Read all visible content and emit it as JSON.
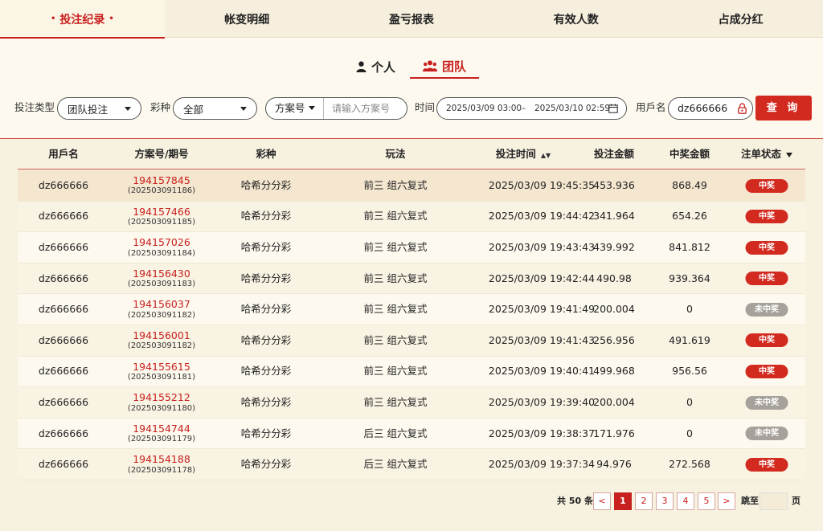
{
  "top_tabs": [
    {
      "label": "投注纪录",
      "active": true
    },
    {
      "label": "帐变明细",
      "active": false
    },
    {
      "label": "盈亏报表",
      "active": false
    },
    {
      "label": "有效人数",
      "active": false
    },
    {
      "label": "占成分红",
      "active": false
    }
  ],
  "active_marker": "•",
  "mode": {
    "personal": "个人",
    "team": "团队",
    "active": "team"
  },
  "filter": {
    "bet_type_label": "投注类型",
    "bet_type_value": "团队投注",
    "lottery_label": "彩种",
    "lottery_value": "全部",
    "plan_type_value": "方案号",
    "plan_placeholder": "请输入方案号",
    "time_label": "时间",
    "time_start": "2025/03/09 03:00",
    "time_sep": "–",
    "time_end": "2025/03/10 02:59",
    "username_label": "用戶名",
    "username_value": "dz666666",
    "query_label": "查 询"
  },
  "table": {
    "headers": [
      "用戶名",
      "方案号/期号",
      "彩种",
      "玩法",
      "投注时间",
      "投注金额",
      "中奖金额",
      "注单状态"
    ],
    "rows": [
      {
        "user": "dz666666",
        "plan": "194157845",
        "issue": "(202503091186)",
        "lottery": "哈希分分彩",
        "play": "前三 组六复式",
        "time": "2025/03/09 19:45:35",
        "amount": "453.936",
        "win": "868.49",
        "status": "中奖"
      },
      {
        "user": "dz666666",
        "plan": "194157466",
        "issue": "(202503091185)",
        "lottery": "哈希分分彩",
        "play": "前三 组六复式",
        "time": "2025/03/09 19:44:42",
        "amount": "341.964",
        "win": "654.26",
        "status": "中奖"
      },
      {
        "user": "dz666666",
        "plan": "194157026",
        "issue": "(202503091184)",
        "lottery": "哈希分分彩",
        "play": "前三 组六复式",
        "time": "2025/03/09 19:43:43",
        "amount": "439.992",
        "win": "841.812",
        "status": "中奖"
      },
      {
        "user": "dz666666",
        "plan": "194156430",
        "issue": "(202503091183)",
        "lottery": "哈希分分彩",
        "play": "前三 组六复式",
        "time": "2025/03/09 19:42:44",
        "amount": "490.98",
        "win": "939.364",
        "status": "中奖"
      },
      {
        "user": "dz666666",
        "plan": "194156037",
        "issue": "(202503091182)",
        "lottery": "哈希分分彩",
        "play": "前三 组六复式",
        "time": "2025/03/09 19:41:49",
        "amount": "200.004",
        "win": "0",
        "status": "未中奖"
      },
      {
        "user": "dz666666",
        "plan": "194156001",
        "issue": "(202503091182)",
        "lottery": "哈希分分彩",
        "play": "前三 组六复式",
        "time": "2025/03/09 19:41:43",
        "amount": "256.956",
        "win": "491.619",
        "status": "中奖"
      },
      {
        "user": "dz666666",
        "plan": "194155615",
        "issue": "(202503091181)",
        "lottery": "哈希分分彩",
        "play": "前三 组六复式",
        "time": "2025/03/09 19:40:41",
        "amount": "499.968",
        "win": "956.56",
        "status": "中奖"
      },
      {
        "user": "dz666666",
        "plan": "194155212",
        "issue": "(202503091180)",
        "lottery": "哈希分分彩",
        "play": "前三 组六复式",
        "time": "2025/03/09 19:39:40",
        "amount": "200.004",
        "win": "0",
        "status": "未中奖"
      },
      {
        "user": "dz666666",
        "plan": "194154744",
        "issue": "(202503091179)",
        "lottery": "哈希分分彩",
        "play": "后三 组六复式",
        "time": "2025/03/09 19:38:37",
        "amount": "171.976",
        "win": "0",
        "status": "未中奖"
      },
      {
        "user": "dz666666",
        "plan": "194154188",
        "issue": "(202503091178)",
        "lottery": "哈希分分彩",
        "play": "后三 组六复式",
        "time": "2025/03/09 19:37:34",
        "amount": "94.976",
        "win": "272.568",
        "status": "中奖"
      }
    ]
  },
  "pagination": {
    "total_text": "共 50 条",
    "prev": "<",
    "pages": [
      "1",
      "2",
      "3",
      "4",
      "5"
    ],
    "current": "1",
    "next": ">",
    "jump_label": "跳至",
    "page_suffix": "页"
  },
  "colors": {
    "accent": "#c8201e",
    "button": "#d32a20",
    "lose_badge": "#a6a19a",
    "page_bg": "#fdf9ee"
  },
  "icons": {
    "personal": "person-icon",
    "team": "team-icon",
    "calendar": "calendar-icon",
    "lock": "lock-icon",
    "sort": "sort-icon",
    "filter": "filter-icon"
  }
}
